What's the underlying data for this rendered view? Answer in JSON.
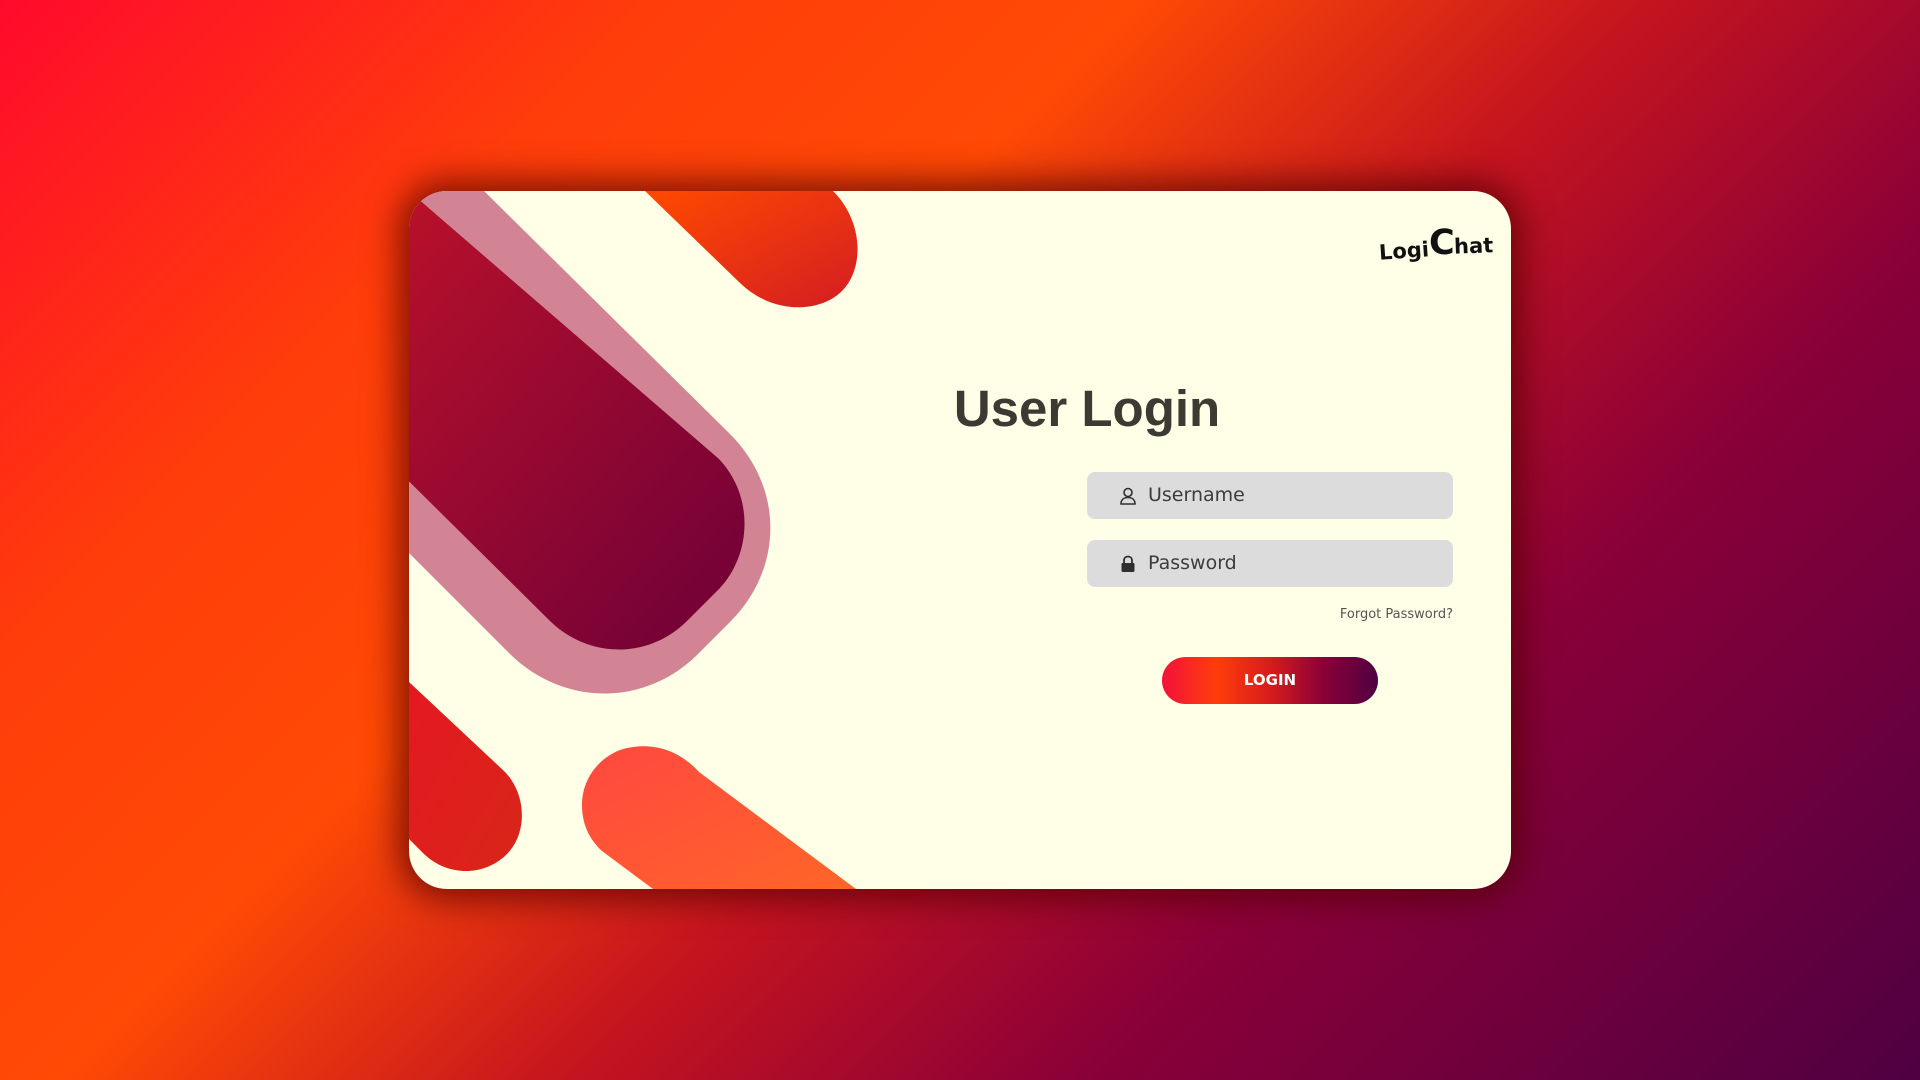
{
  "app": {
    "logo_part_1": "Logi",
    "logo_part_2": "C",
    "logo_part_3": "hat"
  },
  "login_form": {
    "title": "User Login",
    "username_placeholder": "Username",
    "password_placeholder": "Password",
    "forgot_password_label": "Forgot Password?",
    "login_button_label": "LOGIN",
    "username_icon": "user-icon",
    "password_icon": "lock-icon"
  },
  "theme": {
    "card_background": "#fffee6",
    "field_background": "#dddcdc",
    "title_color": "#3b3b33",
    "accent_red": "#ff0a2c",
    "accent_orange": "#ff4a05",
    "accent_purple": "#4f0042"
  }
}
